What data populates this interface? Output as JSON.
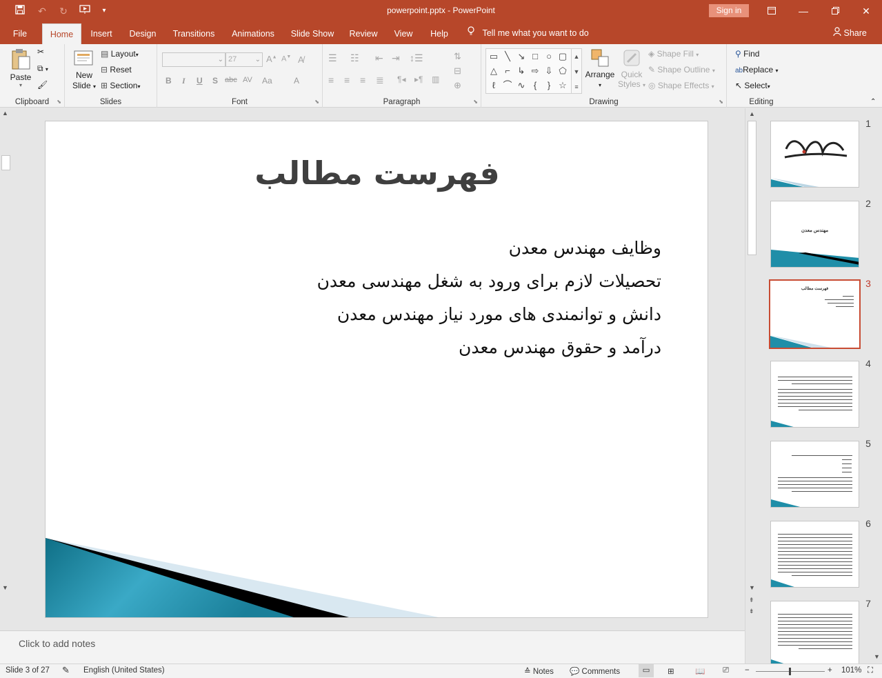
{
  "titlebar": {
    "document_title": "powerpoint.pptx  -  PowerPoint",
    "signin_label": "Sign in",
    "quick_access": [
      "save-icon",
      "undo-icon",
      "redo-icon",
      "start-from-beginning-icon",
      "customize-icon"
    ]
  },
  "tabs": [
    {
      "label": "File"
    },
    {
      "label": "Home"
    },
    {
      "label": "Insert"
    },
    {
      "label": "Design"
    },
    {
      "label": "Transitions"
    },
    {
      "label": "Animations"
    },
    {
      "label": "Slide Show"
    },
    {
      "label": "Review"
    },
    {
      "label": "View"
    },
    {
      "label": "Help"
    }
  ],
  "active_tab": "Home",
  "tell_me": "Tell me what you want to do",
  "share_label": "Share",
  "ribbon": {
    "clipboard": {
      "label": "Clipboard",
      "paste": "Paste"
    },
    "slides": {
      "label": "Slides",
      "new_slide_1": "New",
      "new_slide_2": "Slide",
      "layout": "Layout",
      "reset": "Reset",
      "section": "Section"
    },
    "font": {
      "label": "Font",
      "size": "27",
      "bold": "B",
      "italic": "I",
      "underline": "U",
      "shadow": "S",
      "strike": "abc",
      "spacing": "AV",
      "case": "Aa",
      "color": "A",
      "grow": "A",
      "shrink": "A"
    },
    "paragraph": {
      "label": "Paragraph"
    },
    "drawing": {
      "label": "Drawing",
      "arrange": "Arrange",
      "quick_styles_1": "Quick",
      "quick_styles_2": "Styles",
      "shape_fill": "Shape Fill",
      "shape_outline": "Shape Outline",
      "shape_effects": "Shape Effects"
    },
    "editing": {
      "label": "Editing",
      "find": "Find",
      "replace": "Replace",
      "select": "Select"
    }
  },
  "slide": {
    "title": "فهرست مطالب",
    "bullets": [
      "وظایف مهندس معدن",
      "تحصیلات لازم برای ورود به شغل مهندسی معدن",
      "دانش و توانمندی های مورد نیاز مهندس معدن",
      "درآمد و حقوق مهندس معدن"
    ]
  },
  "thumbnails": [
    {
      "number": "1",
      "selected": false,
      "kind": "calligraphy"
    },
    {
      "number": "2",
      "selected": false,
      "kind": "title",
      "title": "مهندس معدن"
    },
    {
      "number": "3",
      "selected": true,
      "kind": "list",
      "title": "فهرست مطالب"
    },
    {
      "number": "4",
      "selected": false,
      "kind": "text"
    },
    {
      "number": "5",
      "selected": false,
      "kind": "text"
    },
    {
      "number": "6",
      "selected": false,
      "kind": "text"
    },
    {
      "number": "7",
      "selected": false,
      "kind": "text"
    }
  ],
  "notes_placeholder": "Click to add notes",
  "status": {
    "slide_info": "Slide 3 of 27",
    "language": "English (United States)",
    "notes": "Notes",
    "comments": "Comments",
    "zoom": "101%"
  },
  "colors": {
    "accent": "#b7472a",
    "slide_teal": "#1f8ea8",
    "selected_thumb": "#c84b32"
  }
}
